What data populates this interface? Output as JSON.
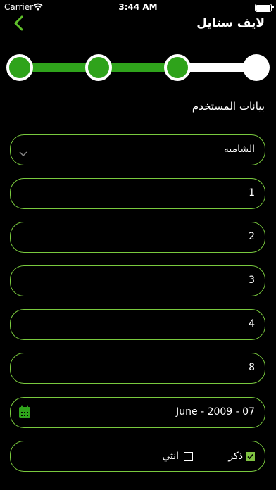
{
  "status_bar": {
    "carrier": "Carrier",
    "time": "3:44 AM"
  },
  "nav": {
    "title": "لايف ستايل"
  },
  "stepper": {
    "total_steps": 4,
    "completed_steps": 3
  },
  "section": {
    "title": "بيانات المستخدم"
  },
  "form": {
    "region_select": "الشاميه",
    "field_1": "1",
    "field_2": "2",
    "field_3": "3",
    "field_4": "4",
    "field_5": "8",
    "date": "07 - June - 2009",
    "gender": {
      "male_label": "ذكر",
      "female_label": "انثي",
      "selected": "male"
    }
  },
  "colors": {
    "accent": "#2fa31b",
    "border": "#79c93e",
    "check": "#7fc242",
    "background": "#000000"
  },
  "icons": [
    "back-chevron-icon",
    "wifi-icon",
    "battery-icon",
    "chevron-down-icon",
    "calendar-icon",
    "checkmark-icon"
  ]
}
